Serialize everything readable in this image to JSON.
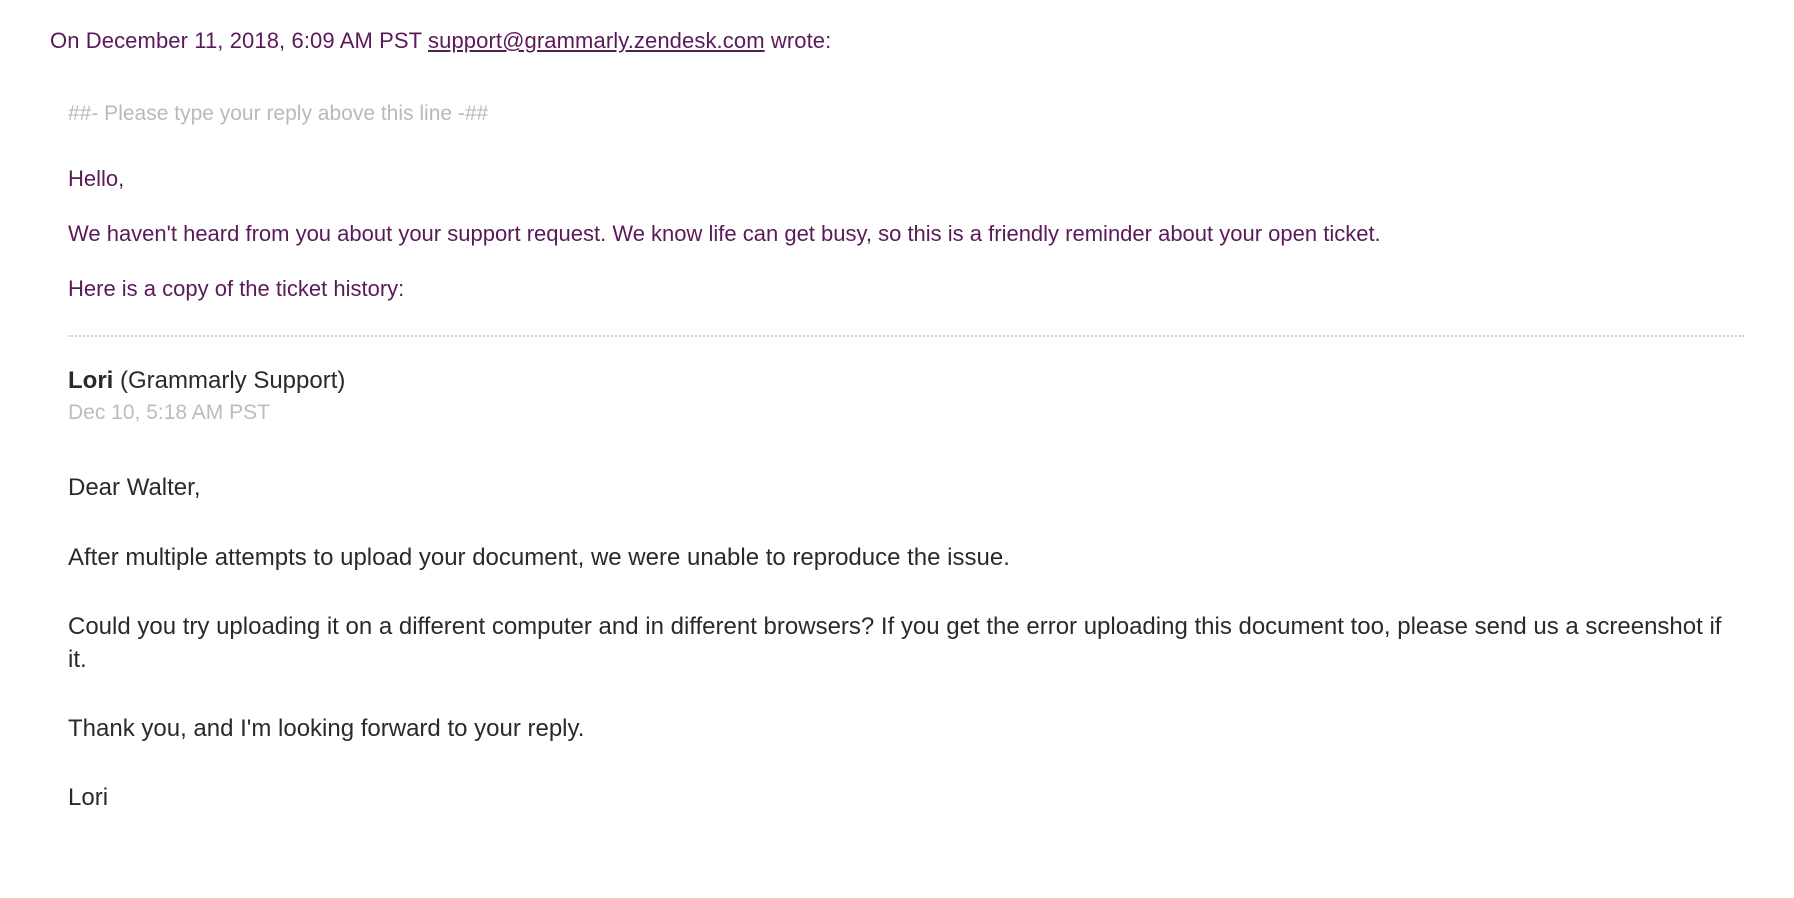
{
  "header": {
    "prefix": "On December 11, 2018, 6:09 AM PST ",
    "email": "support@grammarly.zendesk.com",
    "suffix": " wrote:"
  },
  "replyMarker": "##- Please type your reply above this line -##",
  "intro": {
    "greeting": "Hello,",
    "p1": "We haven't heard from you about your support request. We know life can get busy, so this is a friendly reminder about your open ticket.",
    "p2": "Here is a copy of the ticket history:"
  },
  "ticket": {
    "senderName": "Lori",
    "senderOrg": " (Grammarly Support)",
    "timestamp": "Dec 10, 5:18 AM PST",
    "body": {
      "p1": "Dear Walter,",
      "p2": "After multiple attempts to upload your document, we were unable to reproduce the issue.",
      "p3": "Could you try uploading it on a different computer and in different browsers? If you get the error uploading this document too, please send us a screenshot if it.",
      "p4": "Thank you, and I'm looking forward to your reply.",
      "p5": "Lori"
    }
  }
}
